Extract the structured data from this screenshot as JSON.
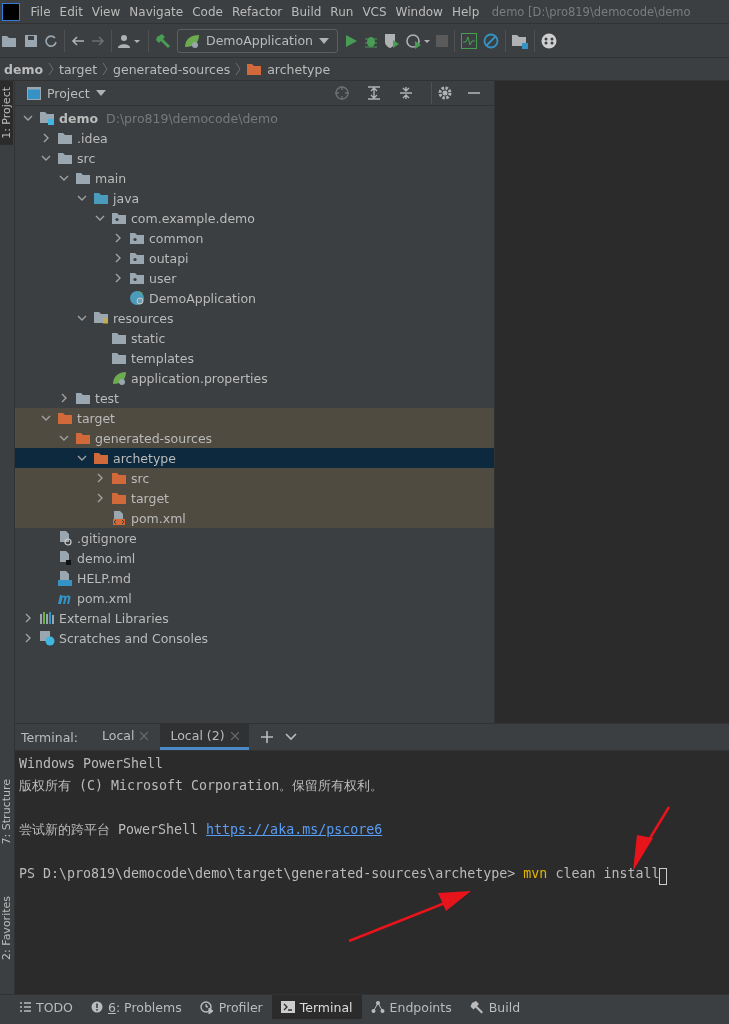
{
  "menu_bar": {
    "items": [
      "File",
      "Edit",
      "View",
      "Navigate",
      "Code",
      "Refactor",
      "Build",
      "Run",
      "VCS",
      "Window",
      "Help"
    ],
    "title": "demo [D:\\pro819\\democode\\demo"
  },
  "toolbar": {
    "run_config": "DemoApplication"
  },
  "breadcrumbs": [
    {
      "label": "demo",
      "kind": "module"
    },
    {
      "label": "target",
      "kind": "plain"
    },
    {
      "label": "generated-sources",
      "kind": "plain"
    },
    {
      "label": "archetype",
      "kind": "folder"
    }
  ],
  "side_stripe": {
    "top": [
      {
        "label": "1: Project",
        "selected": true
      }
    ],
    "bottom": [
      {
        "label": "7: Structure",
        "selected": false
      },
      {
        "label": "2: Favorites",
        "selected": false
      }
    ]
  },
  "project_panel": {
    "title": "Project",
    "tree": [
      {
        "label": "demo",
        "hint": "D:\\pro819\\democode\\demo",
        "kind": "module",
        "expanded": true,
        "excluded": false,
        "selected": false,
        "children": [
          {
            "label": ".idea",
            "kind": "folder",
            "expanded": false,
            "excluded": false,
            "selected": false
          },
          {
            "label": "src",
            "kind": "folder",
            "expanded": true,
            "excluded": false,
            "selected": false,
            "children": [
              {
                "label": "main",
                "kind": "folder",
                "expanded": true,
                "excluded": false,
                "selected": false,
                "children": [
                  {
                    "label": "java",
                    "kind": "source-folder",
                    "expanded": true,
                    "excluded": false,
                    "selected": false,
                    "children": [
                      {
                        "label": "com.example.demo",
                        "kind": "package",
                        "expanded": true,
                        "excluded": false,
                        "selected": false,
                        "children": [
                          {
                            "label": "common",
                            "kind": "package",
                            "expanded": false,
                            "excluded": false,
                            "selected": false
                          },
                          {
                            "label": "outapi",
                            "kind": "package",
                            "expanded": false,
                            "excluded": false,
                            "selected": false
                          },
                          {
                            "label": "user",
                            "kind": "package",
                            "expanded": false,
                            "excluded": false,
                            "selected": false
                          },
                          {
                            "label": "DemoApplication",
                            "kind": "spring-class",
                            "excluded": false,
                            "selected": false
                          }
                        ]
                      }
                    ]
                  },
                  {
                    "label": "resources",
                    "kind": "resource-folder",
                    "expanded": true,
                    "excluded": false,
                    "selected": false,
                    "children": [
                      {
                        "label": "static",
                        "kind": "folder",
                        "excluded": false,
                        "selected": false
                      },
                      {
                        "label": "templates",
                        "kind": "folder",
                        "excluded": false,
                        "selected": false
                      },
                      {
                        "label": "application.properties",
                        "kind": "spring-properties",
                        "excluded": false,
                        "selected": false
                      }
                    ]
                  }
                ]
              },
              {
                "label": "test",
                "kind": "folder",
                "expanded": false,
                "excluded": false,
                "selected": false
              }
            ]
          },
          {
            "label": "target",
            "kind": "excluded-folder",
            "expanded": true,
            "excluded": true,
            "selected": false,
            "children": [
              {
                "label": "generated-sources",
                "kind": "excluded-folder",
                "expanded": true,
                "excluded": true,
                "selected": false,
                "children": [
                  {
                    "label": "archetype",
                    "kind": "excluded-folder",
                    "expanded": true,
                    "excluded": true,
                    "selected": true,
                    "children": [
                      {
                        "label": "src",
                        "kind": "excluded-folder",
                        "expanded": false,
                        "excluded": true,
                        "selected": false
                      },
                      {
                        "label": "target",
                        "kind": "excluded-folder",
                        "expanded": false,
                        "excluded": true,
                        "selected": false
                      },
                      {
                        "label": "pom.xml",
                        "kind": "xml-file",
                        "excluded": true,
                        "selected": false
                      }
                    ]
                  }
                ]
              }
            ]
          },
          {
            "label": ".gitignore",
            "kind": "ignore-file",
            "excluded": false,
            "selected": false
          },
          {
            "label": "demo.iml",
            "kind": "iml-file",
            "excluded": false,
            "selected": false
          },
          {
            "label": "HELP.md",
            "kind": "md-file",
            "excluded": false,
            "selected": false
          },
          {
            "label": "pom.xml",
            "kind": "maven-file",
            "excluded": false,
            "selected": false
          }
        ]
      },
      {
        "label": "External Libraries",
        "kind": "libraries",
        "expanded": false,
        "excluded": false,
        "selected": false
      },
      {
        "label": "Scratches and Consoles",
        "kind": "scratches",
        "expanded": false,
        "excluded": false,
        "selected": false
      }
    ]
  },
  "terminal": {
    "label": "Terminal:",
    "tabs": [
      {
        "label": "Local",
        "selected": false
      },
      {
        "label": "Local (2)",
        "selected": true
      }
    ],
    "lines": [
      {
        "blank_before": false,
        "cursor": false,
        "parts": [
          {
            "text": "Windows PowerShell",
            "kind": "plain"
          }
        ]
      },
      {
        "blank_before": false,
        "cursor": false,
        "parts": [
          {
            "text": "版权所有 (C) Microsoft Corporation。保留所有权利。",
            "kind": "plain"
          }
        ]
      },
      {
        "blank_before": true,
        "cursor": false,
        "parts": [
          {
            "text": "尝试新的跨平台 PowerShell ",
            "kind": "plain"
          },
          {
            "text": "https://aka.ms/pscore6",
            "kind": "link"
          }
        ]
      },
      {
        "blank_before": true,
        "cursor": true,
        "parts": [
          {
            "text": "PS D:\\pro819\\democode\\demo\\target\\generated-sources\\archetype> ",
            "kind": "plain"
          },
          {
            "text": "mvn",
            "kind": "command"
          },
          {
            "text": " clean install",
            "kind": "plain"
          }
        ]
      }
    ]
  },
  "bottom_bar": [
    {
      "label": "TODO",
      "kind": "todo",
      "selected": false
    },
    {
      "label": ": Problems",
      "mnemonic": "6",
      "kind": "problems",
      "selected": false
    },
    {
      "label": "Profiler",
      "kind": "profiler",
      "selected": false
    },
    {
      "label": "Terminal",
      "kind": "terminal",
      "selected": true
    },
    {
      "label": "Endpoints",
      "kind": "endpoints",
      "selected": false
    },
    {
      "label": "Build",
      "kind": "build",
      "selected": false
    }
  ]
}
